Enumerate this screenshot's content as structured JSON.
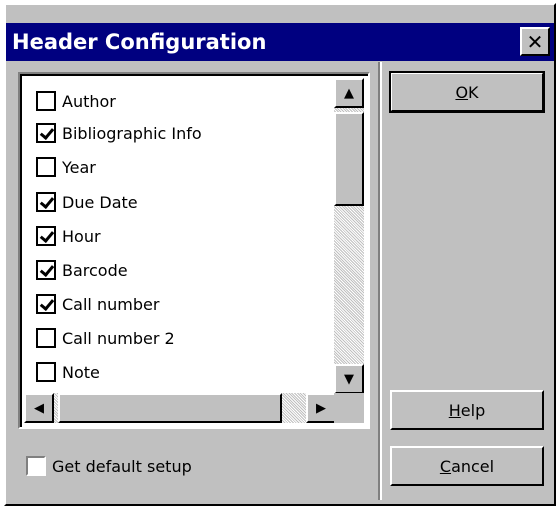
{
  "window": {
    "title": "Header Configuration",
    "close_label": "✕"
  },
  "list": {
    "items": [
      {
        "label": "Author",
        "checked": false
      },
      {
        "label": "Bibliographic Info",
        "checked": true
      },
      {
        "label": "Year",
        "checked": false
      },
      {
        "label": "Due Date",
        "checked": true
      },
      {
        "label": "Hour",
        "checked": true
      },
      {
        "label": "Barcode",
        "checked": true
      },
      {
        "label": "Call number",
        "checked": true
      },
      {
        "label": "Call number 2",
        "checked": false
      },
      {
        "label": "Note",
        "checked": false
      }
    ]
  },
  "buttons": {
    "ok": {
      "underline": "O",
      "rest": "K"
    },
    "help": {
      "underline": "H",
      "rest": "elp"
    },
    "cancel": {
      "underline": "C",
      "rest": "ancel"
    }
  },
  "default_setup": {
    "label": "Get default setup",
    "checked": false
  },
  "scroll_arrows": {
    "up": "▲",
    "down": "▼",
    "left": "◀",
    "right": "▶"
  }
}
